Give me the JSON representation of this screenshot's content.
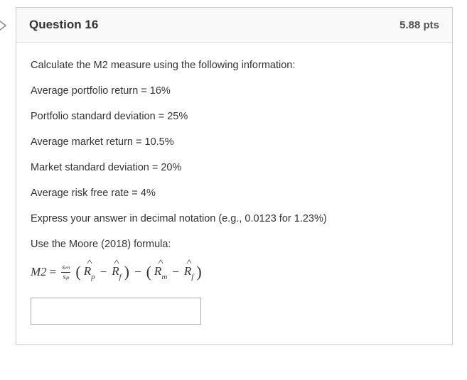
{
  "header": {
    "title": "Question 16",
    "points": "5.88 pts"
  },
  "body": {
    "intro": "Calculate the M2 measure using the following information:",
    "line_portfolio_return": "Average portfolio return = 16%",
    "line_portfolio_sd": "Portfolio standard deviation = 25%",
    "line_market_return": "Average market return = 10.5%",
    "line_market_sd": "Market standard deviation = 20%",
    "line_risk_free": "Average risk free rate = 4%",
    "line_express": "Express your answer in decimal notation (e.g., 0.0123 for 1.23%)",
    "line_useformula": "Use the Moore (2018) formula:"
  },
  "formula": {
    "lhs": "M2",
    "equals": "=",
    "frac_num": "sₘ",
    "frac_den": "sₚ",
    "r_p": "R",
    "r_p_sub": "p",
    "r_f": "R",
    "r_f_sub": "f",
    "r_m": "R",
    "r_m_sub": "m",
    "minus": "−",
    "lparen": "(",
    "rparen": ")"
  },
  "answer": {
    "value": ""
  }
}
